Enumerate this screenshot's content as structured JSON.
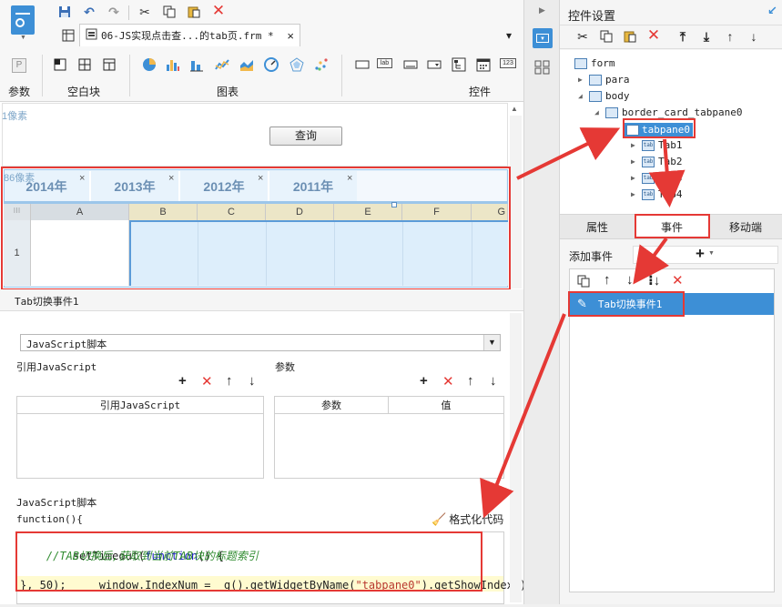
{
  "doc_tab": {
    "title": "06-JS实现点击查...的tab页.frm *",
    "close": "×"
  },
  "ribbon": {
    "groups": [
      {
        "label": "参数"
      },
      {
        "label": "空白块"
      },
      {
        "label": "图表"
      },
      {
        "label": "控件"
      }
    ],
    "param_letter": "P",
    "number_widget": "123",
    "label_widget": "lab"
  },
  "canvas": {
    "px_label_1": "1像素",
    "query_button": "查询",
    "px_label_2": "86像素",
    "tabs": [
      "2014年",
      "2013年",
      "2012年",
      "2011年"
    ],
    "columns": [
      "A",
      "B",
      "C",
      "D",
      "E",
      "F",
      "G"
    ],
    "row_number": "1"
  },
  "event_panel": {
    "event_title": "Tab切换事件1",
    "type_select": "JavaScript脚本",
    "ref_js_label": "引用JavaScript",
    "param_label": "参数",
    "ref_js_header": "引用JavaScript",
    "param_header": "参数",
    "value_header": "值",
    "script_label": "JavaScript脚本",
    "function_head": "function(){",
    "format_code": "格式化代码",
    "code": {
      "line1_a": "setTimeout(",
      "line1_b": "function",
      "line1_c": "() {",
      "line2": "    //TAB切换后,获取到当前TAB块的标题索引",
      "line3_a": "    window.IndexNum = _g().getWidgetByName(",
      "line3_b": "\"tabpane0\"",
      "line3_c": ").getShowIndex();",
      "line4": "}, 50);"
    }
  },
  "right_panel": {
    "title": "控件设置",
    "tree": {
      "form": "form",
      "para": "para",
      "body": "body",
      "border": "border_card_tabpane0",
      "tabpane": "tabpane0",
      "tabs": [
        "Tab1",
        "Tab2",
        "Tab3",
        "Tab4"
      ],
      "tab_icon": "tab"
    },
    "prop_tabs": [
      "属性",
      "事件",
      "移动端"
    ],
    "add_event": "添加事件",
    "event_item": "Tab切换事件1"
  },
  "colors": {
    "accent": "#3d8fd6",
    "red": "#e53935",
    "selected": "#3d8fd6"
  }
}
